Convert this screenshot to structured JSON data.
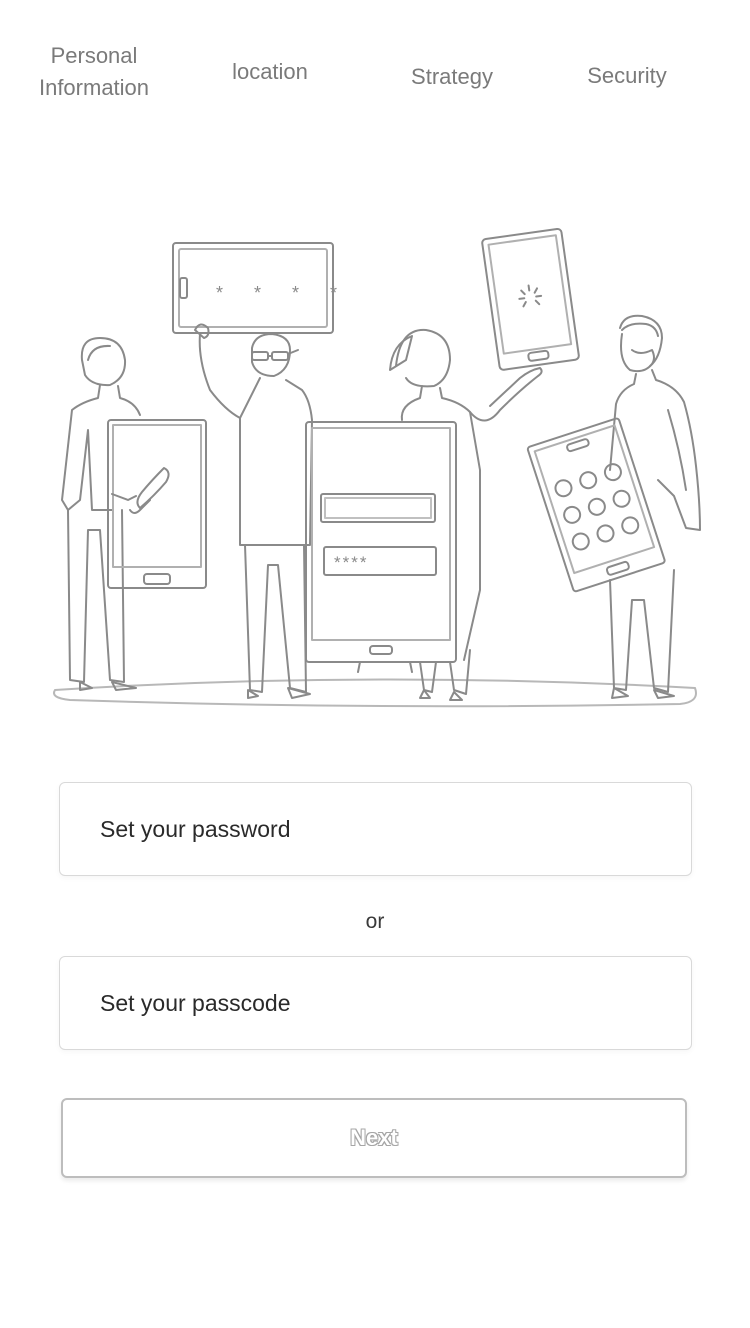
{
  "steps": [
    {
      "label": "Personal\nInformation"
    },
    {
      "label": "location"
    },
    {
      "label": "Strategy"
    },
    {
      "label": "Security"
    }
  ],
  "illustration": {
    "password_mask_top": "* * * *",
    "password_mask_field": "****"
  },
  "form": {
    "password_placeholder": "Set your password",
    "separator": "or",
    "passcode_placeholder": "Set your passcode",
    "next_label": "Next"
  },
  "colors": {
    "text": "#3a3a3a",
    "step_text": "#7a7a7a",
    "border": "#d9d9d9",
    "button_border": "#bdbdbd"
  }
}
